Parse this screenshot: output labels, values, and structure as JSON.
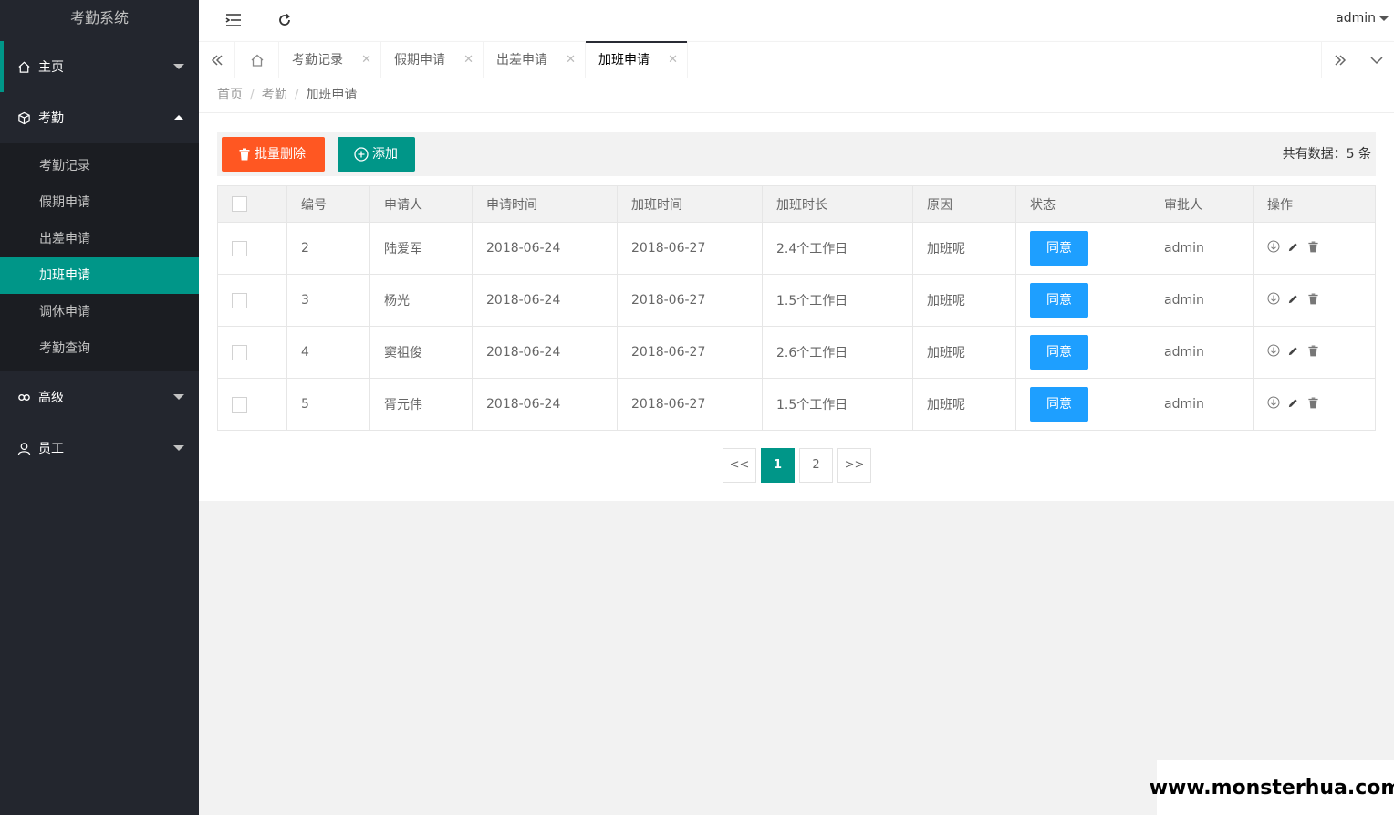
{
  "app": {
    "title": "考勤系统"
  },
  "sidebar": {
    "menu": [
      {
        "label": "主页",
        "icon": "home-icon"
      },
      {
        "label": "考勤",
        "icon": "cube-icon"
      },
      {
        "label": "高级",
        "icon": "link-icon"
      },
      {
        "label": "员工",
        "icon": "user-icon"
      }
    ],
    "submenu": [
      {
        "label": "考勤记录"
      },
      {
        "label": "假期申请"
      },
      {
        "label": "出差申请"
      },
      {
        "label": "加班申请"
      },
      {
        "label": "调休申请"
      },
      {
        "label": "考勤查询"
      }
    ]
  },
  "header": {
    "user": "admin"
  },
  "tabs": [
    {
      "label": "考勤记录"
    },
    {
      "label": "假期申请"
    },
    {
      "label": "出差申请"
    },
    {
      "label": "加班申请"
    }
  ],
  "breadcrumb": {
    "items": [
      "首页",
      "考勤",
      "加班申请"
    ],
    "sep": "/"
  },
  "toolbar": {
    "batch_delete": "批量删除",
    "add": "添加",
    "total": "共有数据：5 条"
  },
  "table": {
    "columns": [
      "编号",
      "申请人",
      "申请时间",
      "加班时间",
      "加班时长",
      "原因",
      "状态",
      "审批人",
      "操作"
    ],
    "rows": [
      {
        "id": "2",
        "applicant": "陆爱军",
        "apply_time": "2018-06-24",
        "ot_time": "2018-06-27",
        "duration": "2.4个工作日",
        "reason": "加班呢",
        "status": "同意",
        "approver": "admin"
      },
      {
        "id": "3",
        "applicant": "杨光",
        "apply_time": "2018-06-24",
        "ot_time": "2018-06-27",
        "duration": "1.5个工作日",
        "reason": "加班呢",
        "status": "同意",
        "approver": "admin"
      },
      {
        "id": "4",
        "applicant": "窦祖俊",
        "apply_time": "2018-06-24",
        "ot_time": "2018-06-27",
        "duration": "2.6个工作日",
        "reason": "加班呢",
        "status": "同意",
        "approver": "admin"
      },
      {
        "id": "5",
        "applicant": "胥元伟",
        "apply_time": "2018-06-24",
        "ot_time": "2018-06-27",
        "duration": "1.5个工作日",
        "reason": "加班呢",
        "status": "同意",
        "approver": "admin"
      }
    ]
  },
  "pager": {
    "prev": "<<",
    "pages": [
      "1",
      "2"
    ],
    "next": ">>"
  },
  "watermark": "www.monsterhua.com",
  "colors": {
    "sidebar": "#23262e",
    "accent": "#009688",
    "danger": "#ff5722",
    "status": "#1e9fff"
  }
}
